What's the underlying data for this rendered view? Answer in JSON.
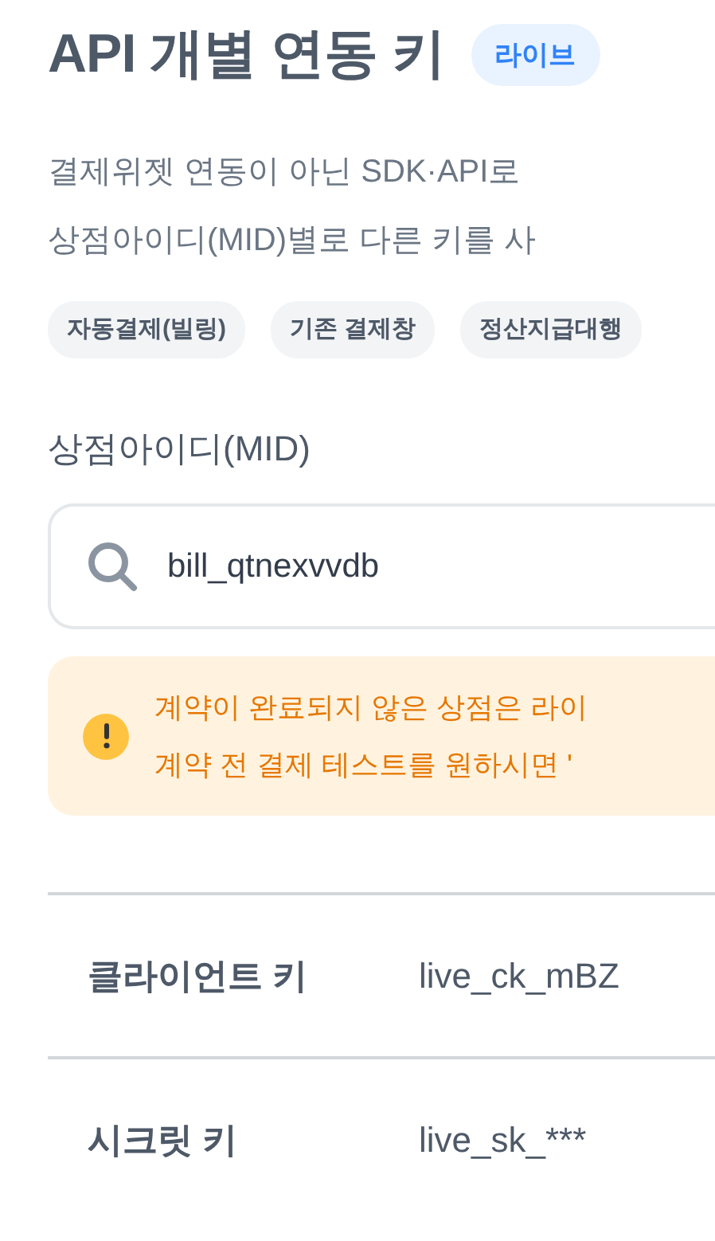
{
  "title": "API 개별 연동 키",
  "badge": "라이브",
  "description": [
    "결제위젯 연동이 아닌 SDK·API로",
    "상점아이디(MID)별로 다른 키를 사"
  ],
  "tags": [
    "자동결제(빌링)",
    "기존 결제창",
    "정산지급대행"
  ],
  "mid_field": {
    "label": "상점아이디(MID)",
    "value": "bill_qtnexvvdb"
  },
  "notice": [
    "계약이 완료되지 않은 상점은 라이",
    "계약 전 결제 테스트를 원하시면 '"
  ],
  "keys": [
    {
      "label": "클라이언트 키",
      "value": "live_ck_mBZ"
    },
    {
      "label": "시크릿 키",
      "value": "live_sk_***"
    }
  ]
}
